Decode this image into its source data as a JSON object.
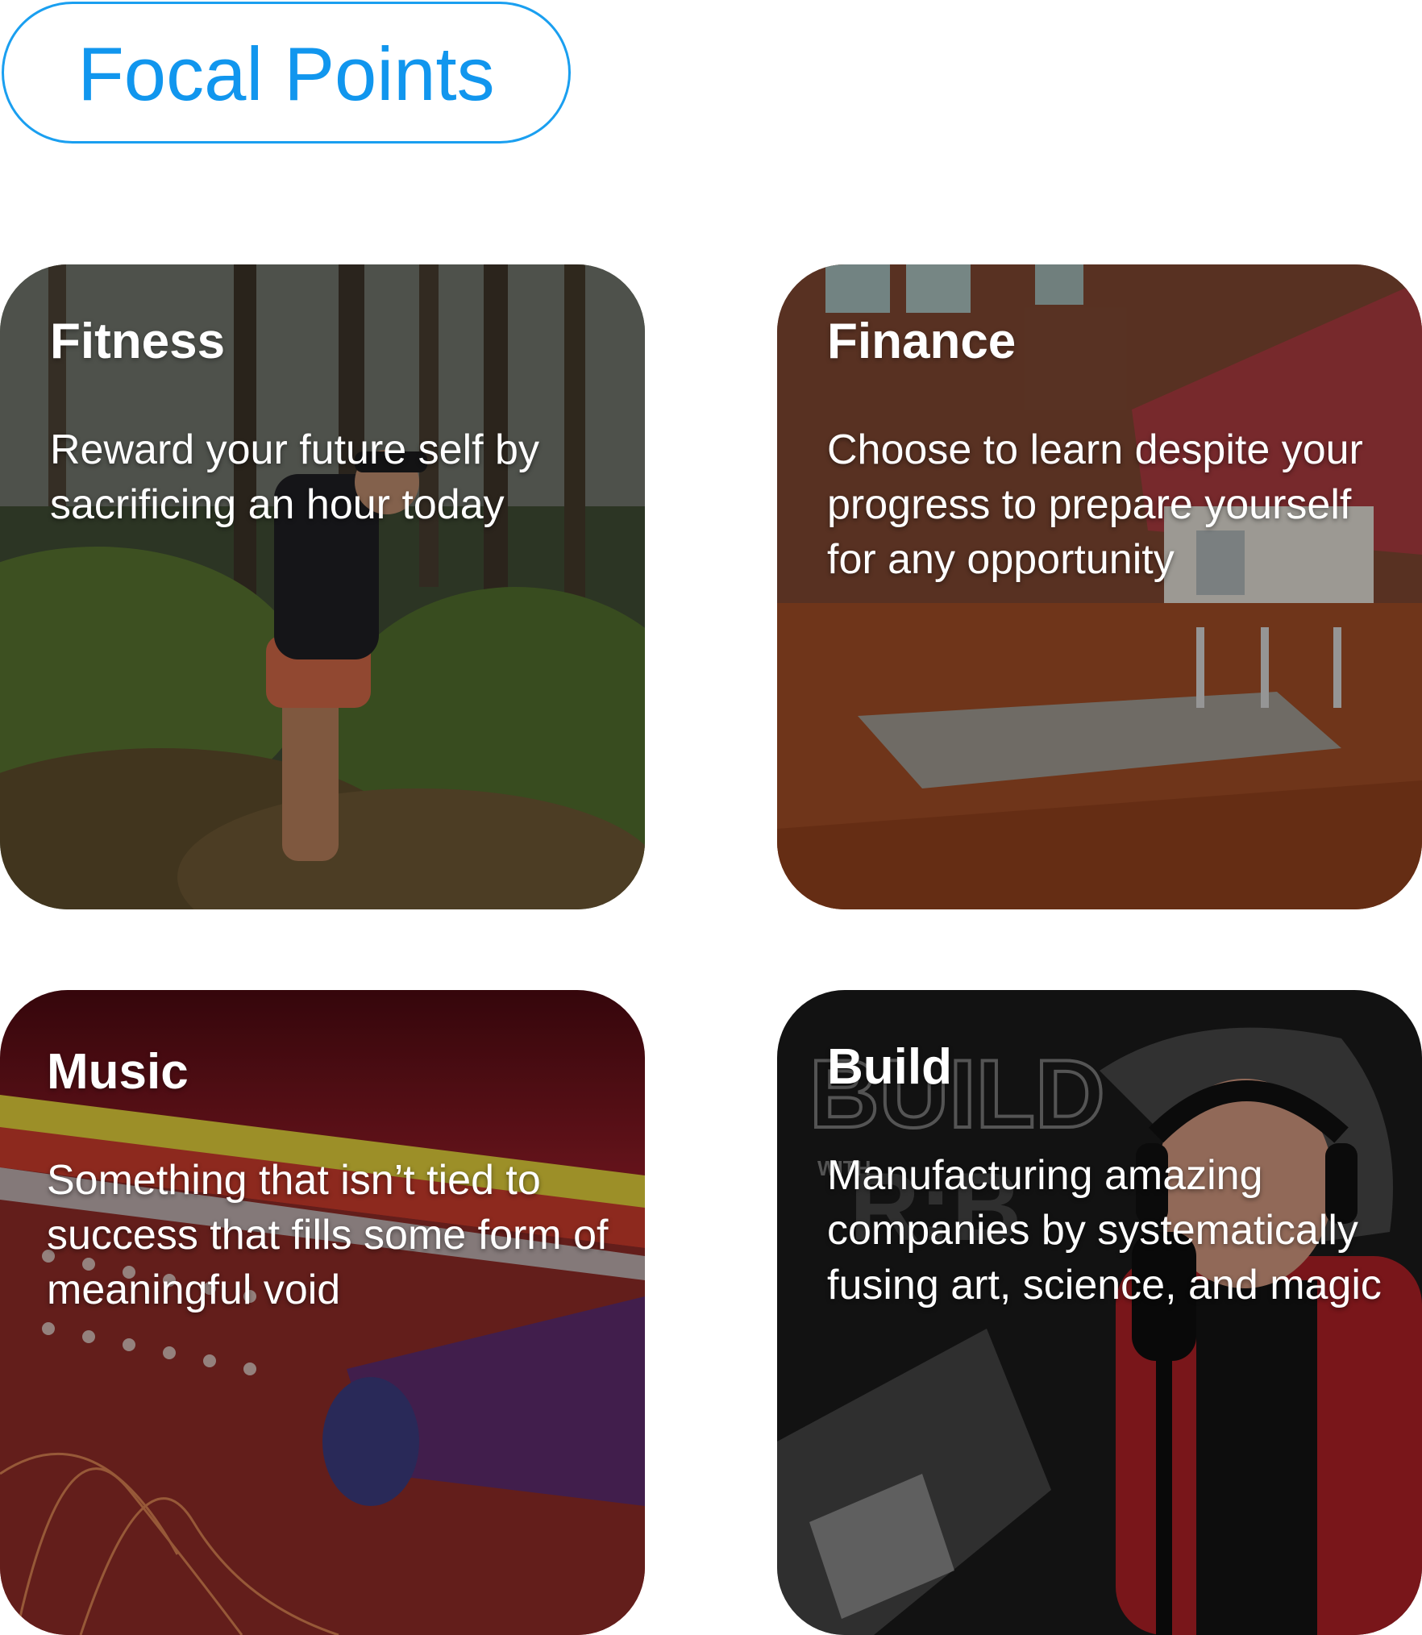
{
  "header": {
    "title": "Focal Points"
  },
  "cards": [
    {
      "title": "Fitness",
      "description": "Reward your future self by sacrificing an hour today",
      "image": "trail-runner-forest-photo"
    },
    {
      "title": "Finance",
      "description": "Choose to learn despite your progress to prepare yourself for any opportunity",
      "image": "loft-interior-photo"
    },
    {
      "title": "Music",
      "description": "Something that isn’t tied to success that fills some form of meaningful void",
      "image": "modular-synth-photo"
    },
    {
      "title": "Build",
      "description": "Manufacturing amazing companies by systematically fusing art, science, and magic",
      "image": "podcast-host-photo",
      "logo_text": "BUILD WITH R:B"
    }
  ]
}
